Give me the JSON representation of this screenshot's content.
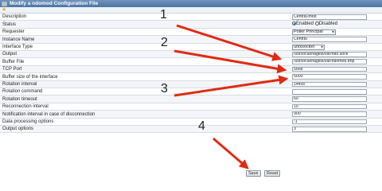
{
  "window": {
    "title": "Modify a ndomod Configuration File"
  },
  "form": {
    "rows": [
      {
        "label": "Description",
        "type": "text",
        "value": "Central-mod"
      },
      {
        "label": "Status",
        "type": "radio",
        "options": [
          "Enabled",
          "Disabled"
        ],
        "selected": "Enabled"
      },
      {
        "label": "Requester",
        "type": "select",
        "value": "Poller Principal"
      },
      {
        "label": "Instance Name",
        "type": "text",
        "value": "Central"
      },
      {
        "label": "Interface Type",
        "type": "select",
        "value": "unixsocket"
      },
      {
        "label": "Output",
        "type": "text",
        "value": "/usr/local/nagios/var/ndo.sock"
      },
      {
        "label": "Buffer File",
        "type": "text",
        "value": "/usr/local/nagios/var/ndomod.tmp"
      },
      {
        "label": "TCP Port",
        "type": "text",
        "value": "5668"
      },
      {
        "label": "Buffer size of the interface",
        "type": "text",
        "value": "5000"
      },
      {
        "label": "Rotation interval",
        "type": "text",
        "value": "14400"
      },
      {
        "label": "Rotation command",
        "type": "text",
        "value": ""
      },
      {
        "label": "Rotation timeout",
        "type": "text",
        "value": "60"
      },
      {
        "label": "Reconnection interval",
        "type": "text",
        "value": "15"
      },
      {
        "label": "Notification interval in case of disconnection",
        "type": "text",
        "value": "900"
      },
      {
        "label": "Data processing options",
        "type": "text",
        "value": "-1"
      },
      {
        "label": "Output options",
        "type": "text",
        "value": "3"
      }
    ]
  },
  "buttons": {
    "save": "Save",
    "reset": "Reset"
  },
  "annotations": {
    "n1": "1",
    "n2": "2",
    "n3": "3",
    "n4": "4"
  },
  "colors": {
    "arrow": "#e02a14",
    "title_bar": "#5b80ad"
  }
}
